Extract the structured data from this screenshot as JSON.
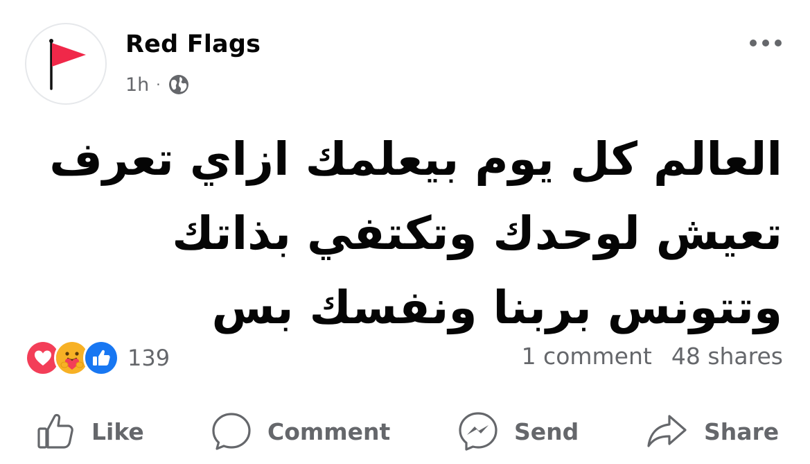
{
  "page": {
    "name": "Red Flags",
    "time": "1h",
    "separator": "·",
    "privacy_icon": "globe-icon",
    "avatar_icon": "red-flag-icon",
    "more_icon": "ellipsis-icon"
  },
  "post": {
    "lines": [
      "العالم كل يوم بيعلمك ازاي تعرف",
      "تعيش لوحدك وتكتفي بذاتك",
      "وتتونس بربنا ونفسك بس"
    ]
  },
  "reactions": {
    "icons": [
      "love-reaction-icon",
      "care-reaction-icon",
      "like-reaction-icon"
    ],
    "count": "139",
    "comments": "1 comment",
    "shares": "48 shares"
  },
  "actions": {
    "like": "Like",
    "comment": "Comment",
    "send": "Send",
    "share": "Share"
  },
  "colors": {
    "flag_red": "#f02849",
    "love_red": "#f33e58",
    "care_yellow": "#f7b125",
    "like_blue": "#1877f2",
    "meta_gray": "#65676b",
    "text": "#050505"
  }
}
